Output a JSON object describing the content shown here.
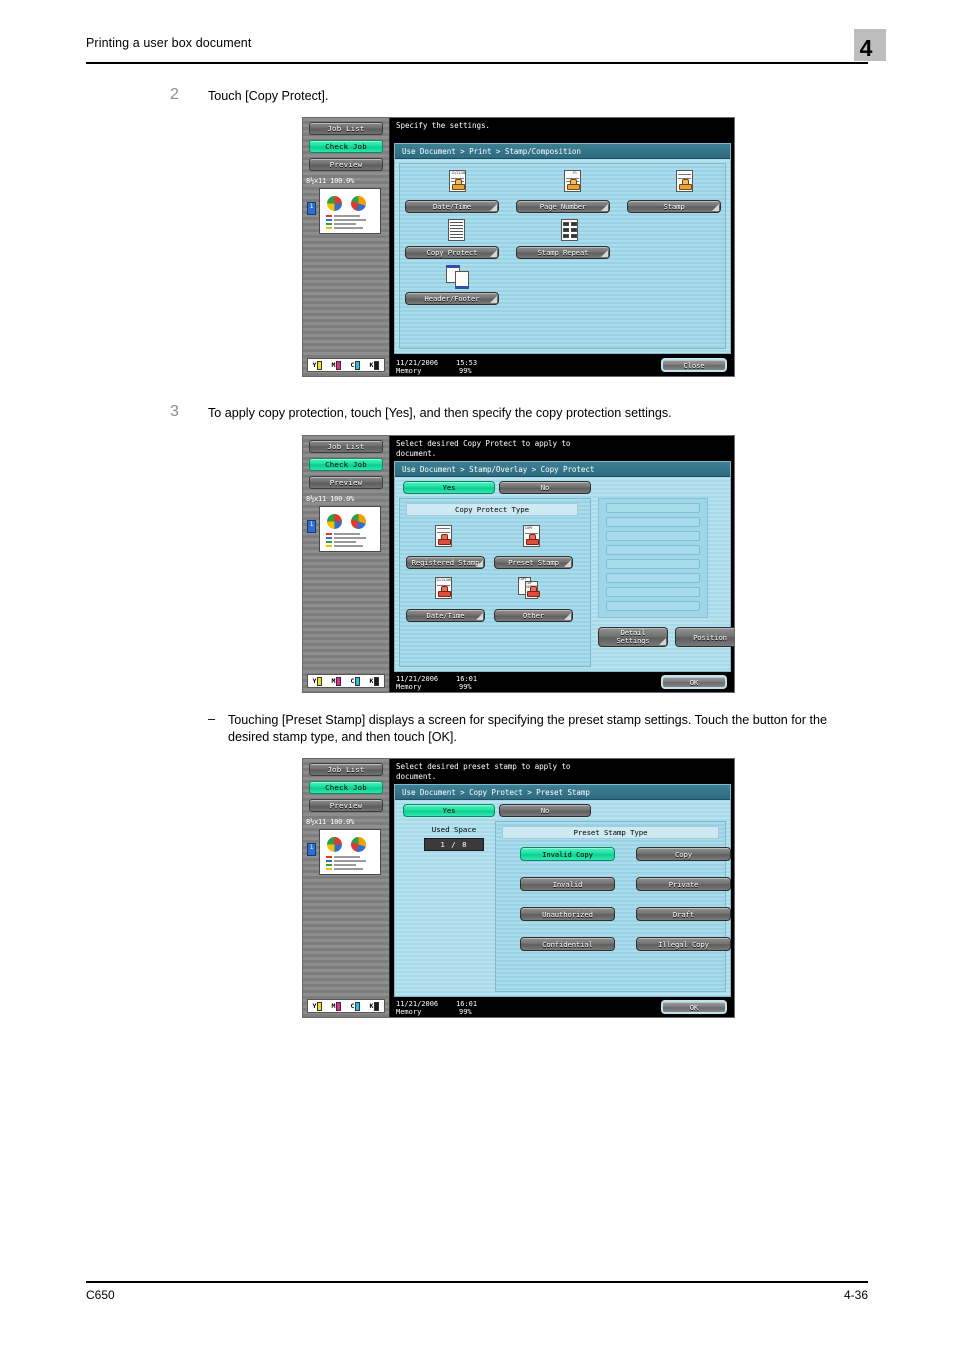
{
  "page": {
    "header_title": "Printing a user box document",
    "chapter_number": "4",
    "footer_model": "C650",
    "footer_page": "4-36"
  },
  "steps": [
    {
      "number": "2",
      "text": "Touch [Copy Protect]."
    },
    {
      "number": "3",
      "text": "To apply copy protection, touch [Yes], and then specify the copy protection settings."
    }
  ],
  "sub_bullet": {
    "dash": "–",
    "text": "Touching [Preset Stamp] displays a screen for specifying the preset stamp settings. Touch the button for the desired stamp type, and then touch [OK]."
  },
  "shared": {
    "side_buttons": [
      {
        "label": "Job List",
        "state": "normal"
      },
      {
        "label": "Check Job",
        "state": "selected"
      },
      {
        "label": "Preview",
        "state": "normal"
      }
    ],
    "paper_info": "8½x11    100.0%",
    "page_mark": "1",
    "toner": [
      {
        "label": "Y",
        "color": "#f2e119"
      },
      {
        "label": "M",
        "color": "#e8279a"
      },
      {
        "label": "C",
        "color": "#25c3e0"
      },
      {
        "label": "K",
        "color": "#1a1a1a"
      }
    ]
  },
  "panel1": {
    "message": "Specify the settings.",
    "breadcrumb": "Use Document > Print > Stamp/Composition",
    "buttons": [
      {
        "label": "Date/Time",
        "icon": "stamp-datetime-icon"
      },
      {
        "label": "Page Number",
        "icon": "stamp-pagenumber-icon"
      },
      {
        "label": "Stamp",
        "icon": "stamp-icon"
      },
      {
        "label": "Copy Protect",
        "icon": "copy-protect-icon"
      },
      {
        "label": "Stamp Repeat",
        "icon": "stamp-repeat-icon"
      },
      {
        "label": "Header/Footer",
        "icon": "header-footer-icon"
      }
    ],
    "close_label": "Close",
    "status": {
      "date": "11/21/2006",
      "time": "15:53",
      "memory_label": "Memory",
      "memory_value": "99%"
    }
  },
  "panel2": {
    "message": "Select desired Copy Protect to apply to\ndocument.",
    "breadcrumb": "Use Document > Stamp/Overlay > Copy Protect",
    "yes_label": "Yes",
    "no_label": "No",
    "section_label": "Copy Protect Type",
    "type_buttons": [
      {
        "label": "Registered Stamp",
        "icon": "registered-stamp-icon"
      },
      {
        "label": "Preset Stamp",
        "icon": "preset-stamp-icon"
      },
      {
        "label": "Date/Time",
        "icon": "datetime-stamp-icon"
      },
      {
        "label": "Other",
        "icon": "other-stamp-icon"
      }
    ],
    "detail_settings_label": "Detail\nSettings",
    "position_label": "Position",
    "list_rows": 8,
    "ok_label": "OK",
    "status": {
      "date": "11/21/2006",
      "time": "16:01",
      "memory_label": "Memory",
      "memory_value": "99%"
    }
  },
  "panel3": {
    "message": "Select desired preset stamp to apply to\ndocument.",
    "breadcrumb": "Use Document > Copy Protect > Preset Stamp",
    "yes_label": "Yes",
    "no_label": "No",
    "used_space_label": "Used Space",
    "used_space_value": "1  /  8",
    "section_label": "Preset Stamp Type",
    "stamp_buttons": [
      {
        "label": "Invalid Copy",
        "state": "selected"
      },
      {
        "label": "Copy",
        "state": "normal"
      },
      {
        "label": "Invalid",
        "state": "normal"
      },
      {
        "label": "Private",
        "state": "normal"
      },
      {
        "label": "Unauthorized",
        "state": "normal"
      },
      {
        "label": "Draft",
        "state": "normal"
      },
      {
        "label": "Confidential",
        "state": "normal"
      },
      {
        "label": "Illegal Copy",
        "state": "normal"
      }
    ],
    "ok_label": "OK",
    "status": {
      "date": "11/21/2006",
      "time": "16:01",
      "memory_label": "Memory",
      "memory_value": "99%"
    }
  }
}
